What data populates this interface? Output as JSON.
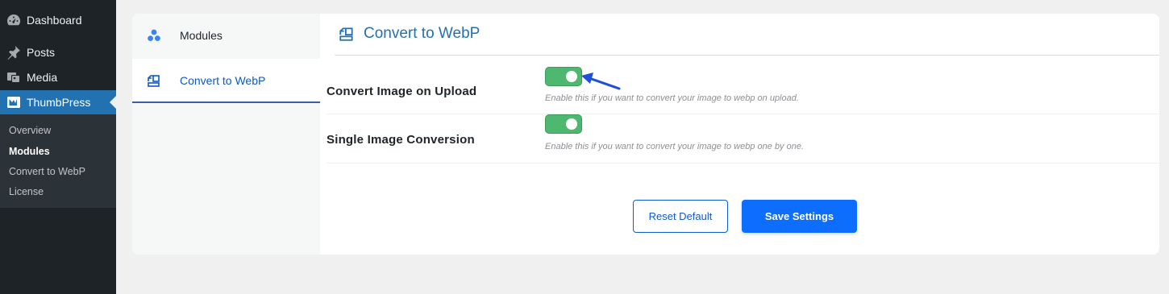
{
  "sidebar": {
    "items": [
      {
        "label": "Dashboard",
        "icon": "dashboard-icon"
      },
      {
        "label": "Posts",
        "icon": "pushpin-icon"
      },
      {
        "label": "Media",
        "icon": "media-icon"
      },
      {
        "label": "ThumbPress",
        "icon": "thumbpress-icon",
        "active": true
      }
    ],
    "submenu": [
      {
        "label": "Overview"
      },
      {
        "label": "Modules",
        "current": true
      },
      {
        "label": "Convert to WebP"
      },
      {
        "label": "License"
      }
    ]
  },
  "plugin_nav": {
    "items": [
      {
        "label": "Modules",
        "icon": "modules-icon"
      },
      {
        "label": "Convert to WebP",
        "icon": "convert-icon",
        "active": true
      }
    ]
  },
  "section": {
    "title": "Convert to WebP",
    "icon": "convert-icon"
  },
  "settings": [
    {
      "label": "Convert Image on Upload",
      "enabled": true,
      "description": "Enable this if you want to convert your image to webp on upload."
    },
    {
      "label": "Single Image Conversion",
      "enabled": true,
      "description": "Enable this if you want to convert your image to webp one by one."
    }
  ],
  "buttons": {
    "reset_label": "Reset Default",
    "save_label": "Save Settings"
  },
  "colors": {
    "admin_bg": "#1d2327",
    "admin_active": "#2271b1",
    "toggle_on": "#4fb870",
    "primary": "#0d6efd",
    "annotation_arrow": "#1e4fd8"
  }
}
